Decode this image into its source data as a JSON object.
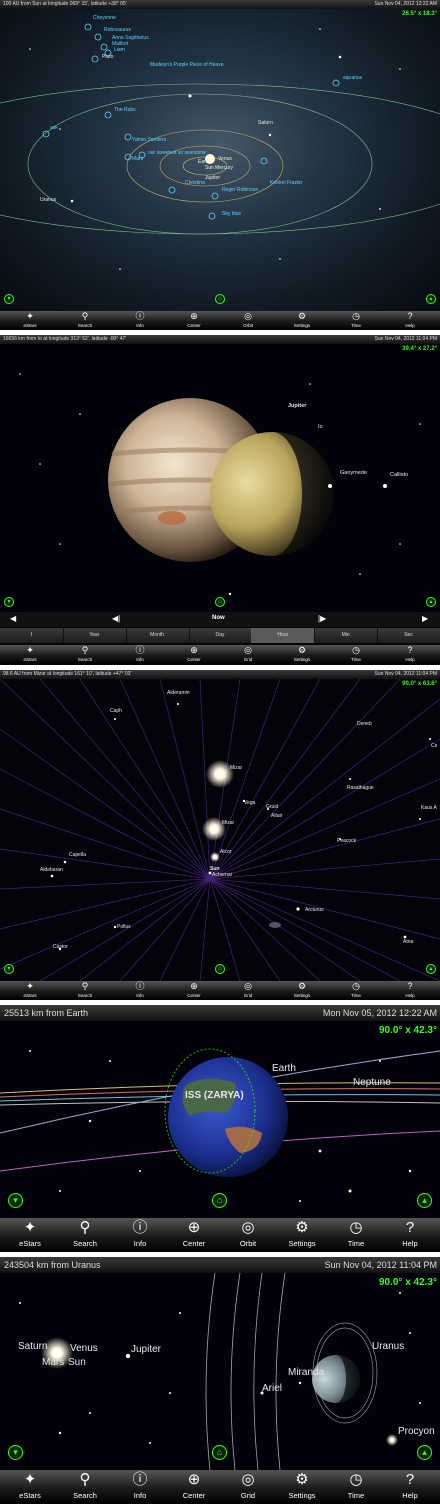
{
  "panels": [
    {
      "status_left": "100 AU from Sun at longitude 069° 15', latitude +38° 05'",
      "status_right": "Sun Nov 04, 2012  12:22 AM",
      "fov": "26.5° x 18.3°",
      "labels": [
        "Cheyenne",
        "Robosaurus",
        "Anna Sagittarius",
        "Mailbot",
        "Liam",
        "Pluto",
        "Madelyn's Purple Piece of Heave",
        "aquarius",
        "The Rabs",
        "Saturn",
        "ask",
        "Yahoo Sanders",
        "our sweetest so awesome",
        "Earth",
        "Venus",
        "Sun",
        "Mercury",
        "Jupiter",
        "Mars",
        "Uranus",
        "Christina",
        "Roger Robinson",
        "Kestrel Frazier",
        "Sky blue"
      ]
    },
    {
      "status_left": "16656 km from Io at longitude 313° 52', latitude -00° 47'",
      "status_right": "Sun Nov 04, 2012  11:04 PM",
      "fov": "39.4° x 27.2°",
      "labels": [
        "Jupiter",
        "Io",
        "Ganymede",
        "Callisto"
      ],
      "time_nav": {
        "now_label": "Now"
      },
      "time_steps": [
        "Year",
        "Month",
        "Day",
        "Hour",
        "Min",
        "Sec"
      ],
      "time_step_selected": "Hour",
      "time_step_first": "I"
    },
    {
      "status_left": "98.6 AU from Mizar at longitude 161° 10', latitude +47° 03'",
      "status_right": "Sun Nov 04, 2012  11:04 PM",
      "fov": "90.0° x 63.6°",
      "labels": [
        "Caph",
        "Alderamin",
        "Deneb",
        "Mizar",
        "Vega",
        "Gruid",
        "Rasalhague",
        "Altair",
        "Kaus A",
        "Mizar",
        "Peacock",
        "Capella",
        "Alcor",
        "Aldebaran",
        "Sun",
        "Achernar",
        "Arcturus",
        "Pollux",
        "Castor",
        "Atria",
        "Ce"
      ]
    },
    {
      "status_left": "25513 km from Earth",
      "status_right": "Mon Nov 05, 2012  12:22 AM",
      "fov": "90.0° x 42.3°",
      "labels": [
        "Earth",
        "Neptune",
        "ISS (ZARYA)"
      ]
    },
    {
      "status_left": "243504 km from Uranus",
      "status_right": "Sun Nov 04, 2012  11:04 PM",
      "fov": "90.0° x 42.3°",
      "labels": [
        "Saturn",
        "Venus",
        "Mars",
        "Sun",
        "Jupiter",
        "Uranus",
        "Miranda",
        "Ariel",
        "Procyon"
      ]
    }
  ],
  "toolbar_small": [
    "eStars",
    "Search",
    "Info",
    "Center",
    "Orbit",
    "Settings",
    "Time",
    "Help"
  ],
  "toolbar_small_alt": [
    "eStars",
    "Search",
    "Info",
    "Center",
    "Grid",
    "Settings",
    "Time",
    "Help"
  ],
  "toolbar_icons": [
    "sparkle-icon",
    "search-icon",
    "info-icon",
    "center-icon",
    "orbit-icon",
    "gear-icon",
    "clock-icon",
    "help-icon"
  ],
  "colors": {
    "fov_green": "#39ff14",
    "accent_green": "#39ff14",
    "constellation_blue": "#5fd0ff",
    "toolbar_bg": "#1a1a1a"
  }
}
